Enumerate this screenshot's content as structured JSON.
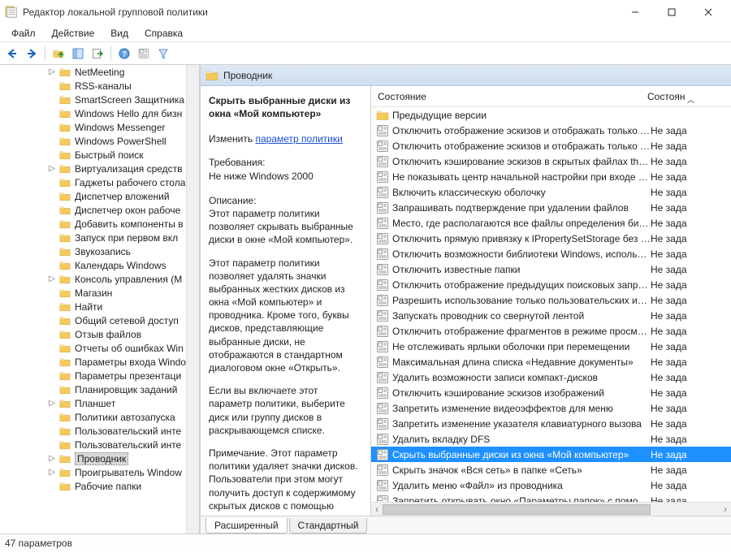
{
  "window": {
    "title": "Редактор локальной групповой политики",
    "menus": [
      "Файл",
      "Действие",
      "Вид",
      "Справка"
    ]
  },
  "tree": {
    "items": [
      {
        "label": "NetMeeting",
        "twist": "▷"
      },
      {
        "label": "RSS-каналы",
        "twist": ""
      },
      {
        "label": "SmartScreen Защитника",
        "twist": ""
      },
      {
        "label": "Windows Hello для бизн",
        "twist": ""
      },
      {
        "label": "Windows Messenger",
        "twist": ""
      },
      {
        "label": "Windows PowerShell",
        "twist": ""
      },
      {
        "label": "Быстрый поиск",
        "twist": ""
      },
      {
        "label": "Виртуализация средств",
        "twist": "▷"
      },
      {
        "label": "Гаджеты рабочего стола",
        "twist": ""
      },
      {
        "label": "Диспетчер вложений",
        "twist": ""
      },
      {
        "label": "Диспетчер окон рабоче",
        "twist": ""
      },
      {
        "label": "Добавить компоненты в",
        "twist": ""
      },
      {
        "label": "Запуск при первом вкл",
        "twist": ""
      },
      {
        "label": "Звукозапись",
        "twist": ""
      },
      {
        "label": "Календарь Windows",
        "twist": ""
      },
      {
        "label": "Консоль управления (М",
        "twist": "▷"
      },
      {
        "label": "Магазин",
        "twist": ""
      },
      {
        "label": "Найти",
        "twist": ""
      },
      {
        "label": "Общий сетевой доступ",
        "twist": ""
      },
      {
        "label": "Отзыв файлов",
        "twist": ""
      },
      {
        "label": "Отчеты об ошибках Win",
        "twist": ""
      },
      {
        "label": "Параметры входа Windo",
        "twist": ""
      },
      {
        "label": "Параметры презентаци",
        "twist": ""
      },
      {
        "label": "Планировщик заданий",
        "twist": ""
      },
      {
        "label": "Планшет",
        "twist": "▷"
      },
      {
        "label": "Политики автозапуска",
        "twist": ""
      },
      {
        "label": "Пользовательский инте",
        "twist": ""
      },
      {
        "label": "Пользовательский инте",
        "twist": ""
      },
      {
        "label": "Проводник",
        "twist": "▷",
        "selected": true
      },
      {
        "label": "Проигрыватель Window",
        "twist": "▷"
      },
      {
        "label": "Рабочие папки",
        "twist": ""
      }
    ]
  },
  "details": {
    "folder_title": "Проводник",
    "setting_title": "Скрыть выбранные диски из окна «Мой компьютер»",
    "edit_label": "Изменить",
    "edit_link": "параметр политики",
    "req_label": "Требования:",
    "req_value": "Не ниже Windows 2000",
    "desc_label": "Описание:",
    "desc_p1": "Этот параметр политики позволяет скрывать выбранные диски в окне «Мой компьютер».",
    "desc_p2": "Этот параметр политики позволяет удалять значки выбранных жестких дисков из окна «Мой компьютер» и проводника. Кроме того, буквы дисков, представляющие выбранные диски, не отображаются в стандартном диалоговом окне «Открыть».",
    "desc_p3": "Если вы включаете этот параметр политики, выберите диск или группу дисков в раскрывающемся списке.",
    "desc_p4": "Примечание. Этот параметр политики удаляет значки дисков. Пользователи при этом могут получить доступ к содержимому скрытых дисков с помощью других методов, например, указав путь к"
  },
  "list": {
    "col_name": "Состояние",
    "col_state": "Состоян",
    "rows": [
      {
        "type": "folder",
        "name": "Предыдущие версии",
        "state": ""
      },
      {
        "type": "setting",
        "name": "Отключить отображение эскизов и отображать только з…",
        "state": "Не зада"
      },
      {
        "type": "setting",
        "name": "Отключить отображение эскизов и отображать только з…",
        "state": "Не зада"
      },
      {
        "type": "setting",
        "name": "Отключить кэширование эскизов в скрытых файлах thu…",
        "state": "Не зада"
      },
      {
        "type": "setting",
        "name": "Не показывать центр начальной настройки при входе по…",
        "state": "Не зада"
      },
      {
        "type": "setting",
        "name": "Включить классическую оболочку",
        "state": "Не зада"
      },
      {
        "type": "setting",
        "name": "Запрашивать подтверждение при удалении файлов",
        "state": "Не зада"
      },
      {
        "type": "setting",
        "name": "Место, где располагаются все файлы определения библ…",
        "state": "Не зада"
      },
      {
        "type": "setting",
        "name": "Отключить прямую привязку к IPropertySetStorage без пр…",
        "state": "Не зада"
      },
      {
        "type": "setting",
        "name": "Отключить возможности библиотеки Windows, использ…",
        "state": "Не зада"
      },
      {
        "type": "setting",
        "name": "Отключить известные папки",
        "state": "Не зада"
      },
      {
        "type": "setting",
        "name": "Отключить отображение предыдущих поисковых запрос…",
        "state": "Не зада"
      },
      {
        "type": "setting",
        "name": "Разрешить использование только пользовательских или …",
        "state": "Не зада"
      },
      {
        "type": "setting",
        "name": "Запускать проводник со свернутой лентой",
        "state": "Не зада"
      },
      {
        "type": "setting",
        "name": "Отключить отображение фрагментов в режиме просмот…",
        "state": "Не зада"
      },
      {
        "type": "setting",
        "name": "Не отслеживать ярлыки оболочки при перемещении",
        "state": "Не зада"
      },
      {
        "type": "setting",
        "name": "Максимальная длина списка «Недавние документы»",
        "state": "Не зада"
      },
      {
        "type": "setting",
        "name": "Удалить возможности записи компакт-дисков",
        "state": "Не зада"
      },
      {
        "type": "setting",
        "name": "Отключить кэширование эскизов изображений",
        "state": "Не зада"
      },
      {
        "type": "setting",
        "name": "Запретить изменение видеоэффектов для меню",
        "state": "Не зада"
      },
      {
        "type": "setting",
        "name": "Запретить изменение указателя клавиатурного вызова",
        "state": "Не зада"
      },
      {
        "type": "setting",
        "name": "Удалить вкладку DFS",
        "state": "Не зада"
      },
      {
        "type": "setting",
        "name": "Скрыть выбранные диски из окна «Мой компьютер»",
        "state": "Не зада",
        "selected": true
      },
      {
        "type": "setting",
        "name": "Скрыть значок «Вся сеть» в папке «Сеть»",
        "state": "Не зада"
      },
      {
        "type": "setting",
        "name": "Удалить меню «Файл» из проводника",
        "state": "Не зада"
      },
      {
        "type": "setting",
        "name": "Запретить открывать окно «Параметры папок» с помощ…",
        "state": "Не зада"
      }
    ]
  },
  "tabs": {
    "extended": "Расширенный",
    "standard": "Стандартный"
  },
  "status": {
    "text": "47 параметров"
  }
}
